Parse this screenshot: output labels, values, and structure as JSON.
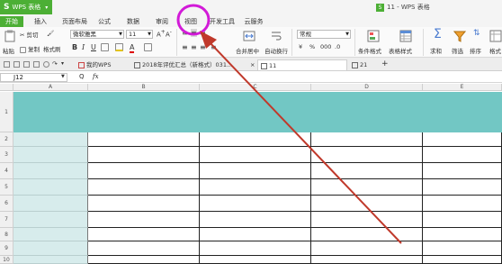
{
  "app": {
    "name": "WPS 表格",
    "window_title": "11 - WPS 表格"
  },
  "menu_tabs": [
    "开始",
    "插入",
    "页面布局",
    "公式",
    "数据",
    "审阅",
    "视图",
    "开发工具",
    "云服务"
  ],
  "ribbon": {
    "paste": "粘贴",
    "cut": "剪切",
    "copy": "复制",
    "format_painter": "格式刷",
    "font_name": "微软雅黑",
    "font_size": "11",
    "bold": "B",
    "italic": "I",
    "underline": "U",
    "merge_center": "合并居中",
    "wrap_text": "自动换行",
    "number_format": "常规",
    "conditional_format": "条件格式",
    "table_style": "表格样式",
    "sum": "求和",
    "filter": "筛选",
    "sort": "排序",
    "format": "格式"
  },
  "doc_tabs": [
    "我的WPS",
    "2018年评优汇总（新格式）031...",
    "11",
    "21"
  ],
  "name_box": "J12",
  "fx_label": "fx",
  "columns": [
    "A",
    "B",
    "C",
    "D",
    "E"
  ],
  "rows": [
    "1",
    "2",
    "3",
    "4",
    "5",
    "6",
    "7",
    "8",
    "9",
    "10"
  ],
  "colors": {
    "accent_green": "#4caf35",
    "header_teal": "#72c7c4",
    "highlight_circle": "#d21ad8",
    "arrow_red": "#c0392b"
  }
}
